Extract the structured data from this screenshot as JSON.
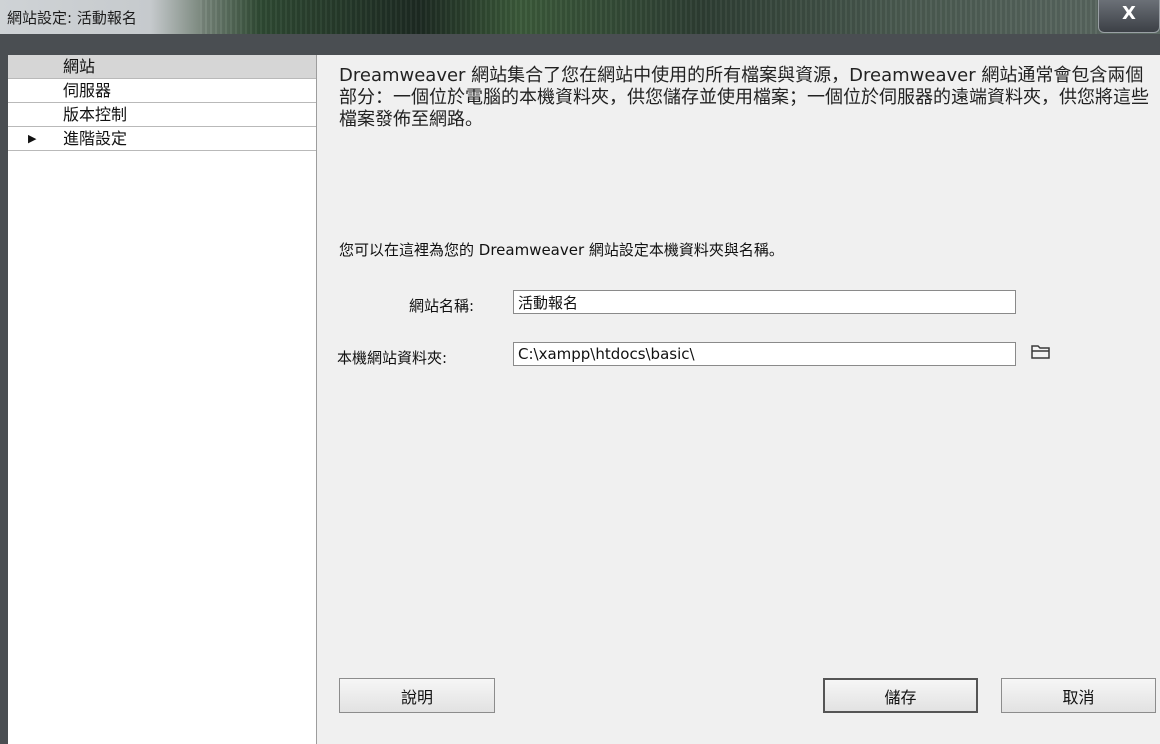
{
  "window": {
    "title": "網站設定: 活動報名",
    "close_label": "X"
  },
  "sidebar": {
    "items": [
      {
        "label": "網站"
      },
      {
        "label": "伺服器"
      },
      {
        "label": "版本控制"
      },
      {
        "label": "進階設定",
        "arrow": "▶"
      }
    ]
  },
  "main": {
    "description": "Dreamweaver 網站集合了您在網站中使用的所有檔案與資源，Dreamweaver 網站通常會包含兩個部分：一個位於電腦的本機資料夾，供您儲存並使用檔案；一個位於伺服器的遠端資料夾，供您將這些檔案發佈至網路。",
    "instruction": "您可以在這裡為您的 Dreamweaver 網站設定本機資料夾與名稱。",
    "site_name": {
      "label": "網站名稱:",
      "value": "活動報名"
    },
    "local_folder": {
      "label": "本機網站資料夾:",
      "value": "C:\\xampp\\htdocs\\basic\\",
      "icon": "folder-icon"
    }
  },
  "buttons": {
    "help": "說明",
    "save": "儲存",
    "cancel": "取消"
  }
}
